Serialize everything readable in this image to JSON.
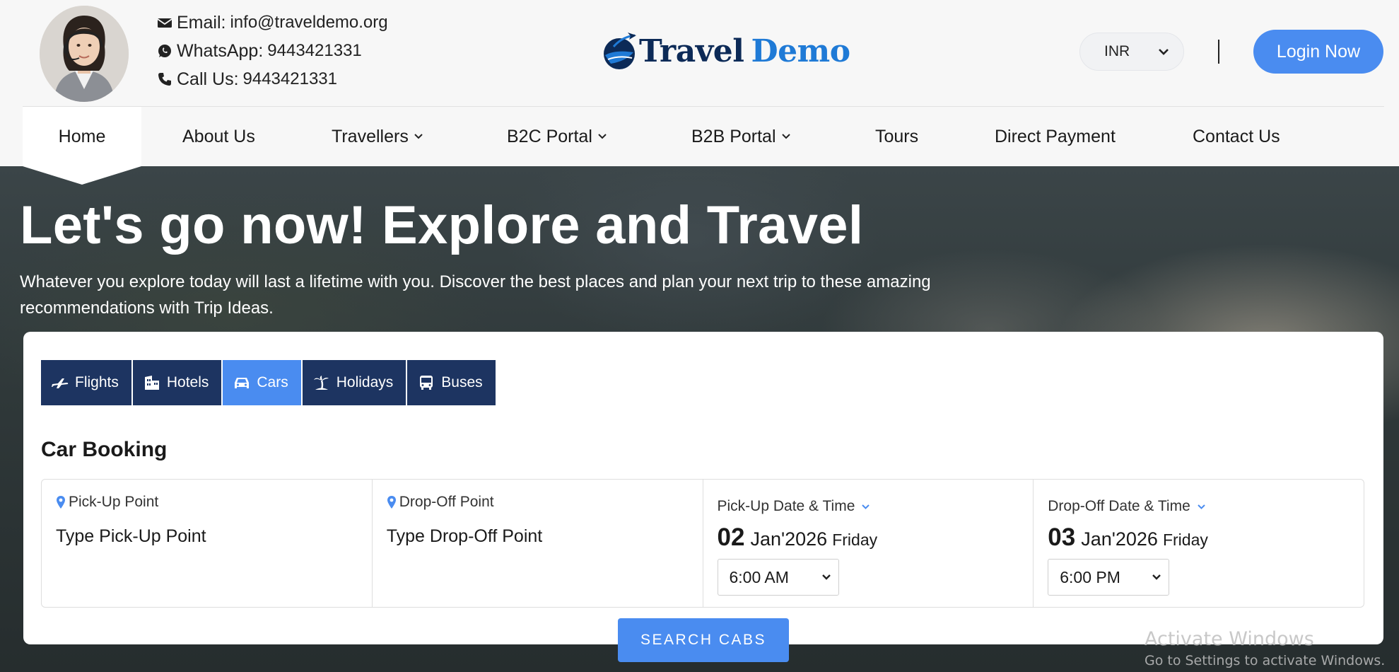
{
  "header": {
    "contact": {
      "email_label": "Email:",
      "email_value": "info@traveldemo.org",
      "whatsapp_label": "WhatsApp:",
      "whatsapp_value": "9443421331",
      "call_label": "Call Us:",
      "call_value": "9443421331"
    },
    "logo": {
      "word1": "Travel",
      "word2": "Demo"
    },
    "currency": "INR",
    "login_label": "Login Now"
  },
  "nav": {
    "items": [
      {
        "label": "Home",
        "dropdown": false,
        "active": true
      },
      {
        "label": "About Us",
        "dropdown": false
      },
      {
        "label": "Travellers",
        "dropdown": true
      },
      {
        "label": "B2C Portal",
        "dropdown": true
      },
      {
        "label": "B2B Portal",
        "dropdown": true
      },
      {
        "label": "Tours",
        "dropdown": false
      },
      {
        "label": "Direct Payment",
        "dropdown": false
      },
      {
        "label": "Contact Us",
        "dropdown": false
      }
    ]
  },
  "hero": {
    "title": "Let's go now! Explore and Travel",
    "subtitle": "Whatever you explore today will last a lifetime with you. Discover the best places and plan your next trip to these amazing recommendations with Trip Ideas."
  },
  "booking": {
    "tabs": [
      {
        "label": "Flights",
        "icon": "plane-icon"
      },
      {
        "label": "Hotels",
        "icon": "hotel-icon"
      },
      {
        "label": "Cars",
        "icon": "car-icon",
        "active": true
      },
      {
        "label": "Holidays",
        "icon": "palm-tree-icon"
      },
      {
        "label": "Buses",
        "icon": "bus-icon"
      }
    ],
    "heading": "Car Booking",
    "pickup": {
      "label": "Pick-Up Point",
      "placeholder": "Type Pick-Up Point"
    },
    "dropoff": {
      "label": "Drop-Off Point",
      "placeholder": "Type Drop-Off Point"
    },
    "pickup_date": {
      "label": "Pick-Up Date & Time",
      "day": "02",
      "month_year": "Jan'2026",
      "weekday": "Friday",
      "time": "6:00 AM"
    },
    "dropoff_date": {
      "label": "Drop-Off Date & Time",
      "day": "03",
      "month_year": "Jan'2026",
      "weekday": "Friday",
      "time": "6:00 PM"
    },
    "search_label": "SEARCH CABS"
  },
  "watermark": {
    "line1": "Activate Windows",
    "line2": "Go to Settings to activate Windows."
  },
  "colors": {
    "accent": "#4a8cf0",
    "navy": "#1d3461",
    "logo_dark": "#0c2a57",
    "logo_blue": "#1f7ad6"
  }
}
